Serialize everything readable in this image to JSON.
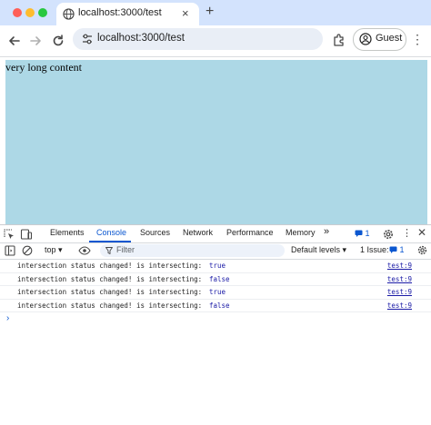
{
  "browser": {
    "tab_title": "localhost:3000/test",
    "tab_close": "×",
    "new_tab": "+",
    "url": "localhost:3000/test",
    "profile_label": "Guest",
    "menu": "⋮"
  },
  "page": {
    "content_text": "very long content",
    "content_bg": "#add8e6"
  },
  "devtools": {
    "tabs": [
      "Elements",
      "Console",
      "Sources",
      "Network",
      "Performance",
      "Memory"
    ],
    "more_tabs": "»",
    "active_tab": "Console",
    "message_count": "1",
    "menu": "⋮",
    "close": "✕",
    "context": "top ▾",
    "filter_placeholder": "Filter",
    "levels": "Default levels ▾",
    "issues_label": "1 Issue:",
    "issues_count": "1",
    "logs": [
      {
        "message": "intersection status changed! is intersecting:",
        "value": "true",
        "source": "test:9"
      },
      {
        "message": "intersection status changed! is intersecting:",
        "value": "false",
        "source": "test:9"
      },
      {
        "message": "intersection status changed! is intersecting:",
        "value": "true",
        "source": "test:9"
      },
      {
        "message": "intersection status changed! is intersecting:",
        "value": "false",
        "source": "test:9"
      }
    ],
    "prompt": "›"
  },
  "colors": {
    "accent": "#0b57d0",
    "tabstrip": "#d3e3fd",
    "value_blue": "#1a1aa6"
  }
}
